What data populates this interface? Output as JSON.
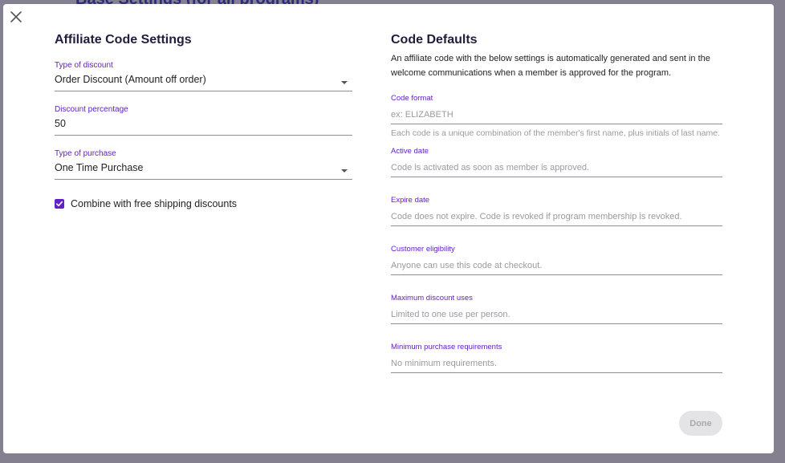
{
  "background": {
    "heading": "Base Settings (for all programs)"
  },
  "modal": {
    "close_icon": "close-icon"
  },
  "affiliate": {
    "title": "Affiliate Code Settings",
    "type_of_discount": {
      "label": "Type of discount",
      "value": "Order Discount (Amount off order)"
    },
    "discount_percentage": {
      "label": "Discount percentage",
      "value": "50"
    },
    "type_of_purchase": {
      "label": "Type of purchase",
      "value": "One Time Purchase"
    },
    "combine_free_shipping": {
      "label": "Combine with free shipping discounts",
      "checked": true
    }
  },
  "defaults": {
    "title": "Code Defaults",
    "description": "An affiliate code with the below settings is automatically generated and sent in the welcome communications when a member is approved for the program.",
    "code_format": {
      "label": "Code format",
      "placeholder": "ex: ELIZABETH",
      "helper": "Each code is a unique combination of the member's first name, plus initials of last name."
    },
    "active_date": {
      "label": "Active date",
      "placeholder": "Code is activated as soon as member is approved."
    },
    "expire_date": {
      "label": "Expire date",
      "placeholder": "Code does not expire. Code is revoked if program membership is revoked."
    },
    "customer_eligibility": {
      "label": "Customer eligibility",
      "placeholder": "Anyone can use this code at checkout."
    },
    "max_discount_uses": {
      "label": "Maximum discount uses",
      "placeholder": "Limited to one use per person."
    },
    "min_purchase": {
      "label": "Minimum purchase requirements",
      "placeholder": "No minimum requirements."
    }
  },
  "footer": {
    "done_label": "Done"
  },
  "colors": {
    "accent": "#6220c8",
    "overlay": "#85808f",
    "disabled_button": "#e4e4e7"
  }
}
